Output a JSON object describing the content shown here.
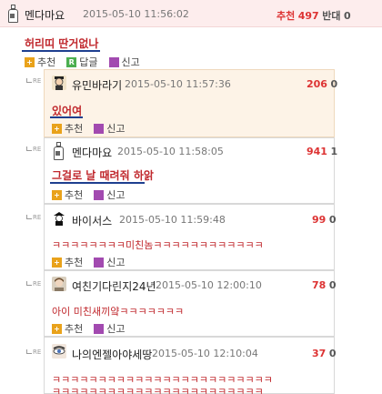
{
  "top": {
    "nickname": "멘다마요",
    "date": "2015-05-10 11:56:02",
    "upvote_label": "추천",
    "upvote_count": "497",
    "downvote_label": "반대",
    "downvote_count": "0",
    "content": "허리띠 딴거없나",
    "actions": {
      "recommend": "추천",
      "reply": "답글",
      "report": "신고"
    }
  },
  "replies": [
    {
      "tag": "RE",
      "nickname": "유민바라기",
      "date": "2015-05-10 11:57:36",
      "up": "206",
      "down": "0",
      "content": "있어여",
      "recommend": "추천",
      "report": "신고"
    },
    {
      "tag": "RE",
      "nickname": "멘다마요",
      "date": "2015-05-10 11:58:05",
      "up": "941",
      "down": "1",
      "content": "그걸로 날 때려줘 하앍",
      "recommend": "추천",
      "report": "신고"
    },
    {
      "tag": "RE",
      "nickname": "바이서스",
      "date": "2015-05-10 11:59:48",
      "up": "99",
      "down": "0",
      "content": "ㅋㅋㅋㅋㅋㅋㅋㅋ미친놈ㅋㅋㅋㅋㅋㅋㅋㅋㅋㅋㅋㅋ",
      "recommend": "추천",
      "report": "신고"
    },
    {
      "tag": "RE",
      "nickname": "여친기다린지24년",
      "date": "2015-05-10 12:00:10",
      "up": "78",
      "down": "0",
      "content": "아이 미친새끼얔ㅋㅋㅋㅋㅋㅋㅋ",
      "recommend": "추천",
      "report": "신고"
    },
    {
      "tag": "RE",
      "nickname": "나의엔젤아야세땅",
      "date": "2015-05-10 12:10:04",
      "up": "37",
      "down": "0",
      "content": "ㅋㅋㅋㅋㅋㅋㅋㅋㅋㅋㅋㅋㅋㅋㅋㅋㅋㅋㅋㅋㅋㅋㅋㅋ",
      "content2": "ㅋㅋㅋㅋㅋㅋㅋㅋㅋㅋㅋㅋㅋㅋㅋㅋㅋㅋㅋㅋㅋㅋㅋ"
    }
  ]
}
